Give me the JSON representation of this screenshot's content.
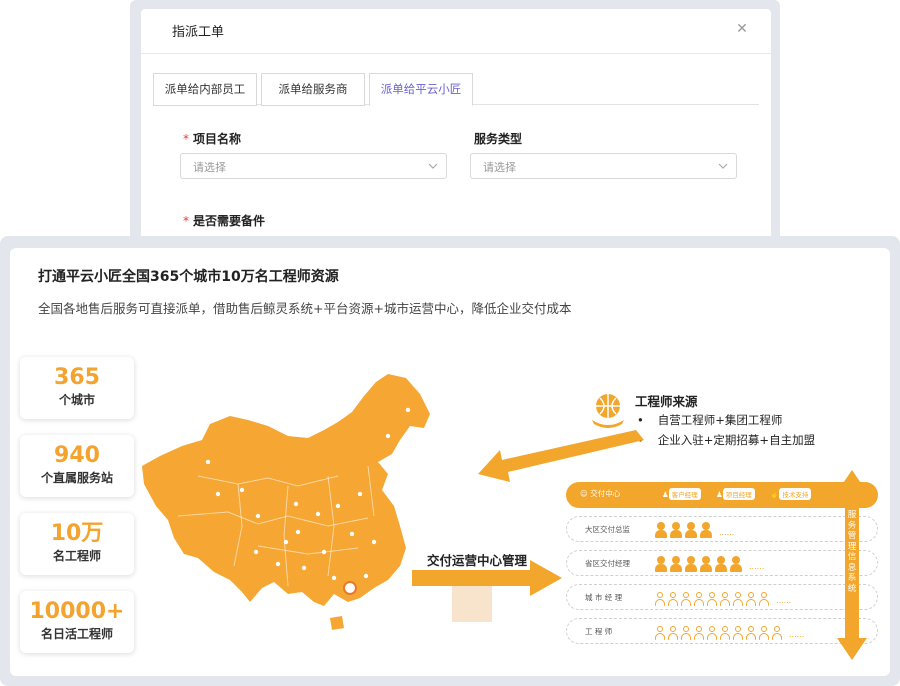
{
  "dialog": {
    "title": "指派工单",
    "close_icon": "close-icon",
    "tabs": [
      {
        "label": "派单给内部员工",
        "active": false
      },
      {
        "label": "派单给服务商",
        "active": false
      },
      {
        "label": "派单给平云小匠",
        "active": true
      }
    ],
    "fields": {
      "project_name": {
        "label": "项目名称",
        "required": true,
        "placeholder": "请选择"
      },
      "service_type": {
        "label": "服务类型",
        "required": false,
        "placeholder": "请选择"
      },
      "need_parts": {
        "label": "是否需要备件",
        "required": true
      }
    }
  },
  "promo": {
    "title": "打通平云小匠全国365个城市10万名工程师资源",
    "subtitle": "全国各地售后服务可直接派单，借助售后鲸灵系统+平台资源+城市运营中心，降低企业交付成本",
    "stats": [
      {
        "number": "365",
        "label": "个城市"
      },
      {
        "number": "940",
        "label": "个直属服务站"
      },
      {
        "number": "10万",
        "label": "名工程师"
      },
      {
        "number": "10000+",
        "label": "名日活工程师"
      }
    ],
    "engineer_source": {
      "title": "工程师来源",
      "items": [
        "自营工程师+集团工程师",
        "企业入驻+定期招募+自主加盟"
      ]
    },
    "mgmt_label": "交付运营中心管理",
    "org": {
      "header": {
        "center": "交付中心",
        "pills": [
          "客户经理",
          "项目经理",
          "技术支持"
        ]
      },
      "tiers": [
        {
          "name": "大区交付总监",
          "count": 4,
          "style": "filled-big",
          "dots": "......"
        },
        {
          "name": "省区交付经理",
          "count": 6,
          "style": "filled-big",
          "dots": "......"
        },
        {
          "name": "城 市 经 理",
          "count": 9,
          "style": "outline",
          "dots": "......"
        },
        {
          "name": "工  程  师",
          "count": 10,
          "style": "outline",
          "dots": "......"
        }
      ],
      "vertical_label": "服务管理信息系统"
    },
    "colors": {
      "accent": "#f2a62c",
      "map": "#f5a633",
      "tab_active": "#6b5fd3",
      "required": "#e0413c"
    }
  }
}
